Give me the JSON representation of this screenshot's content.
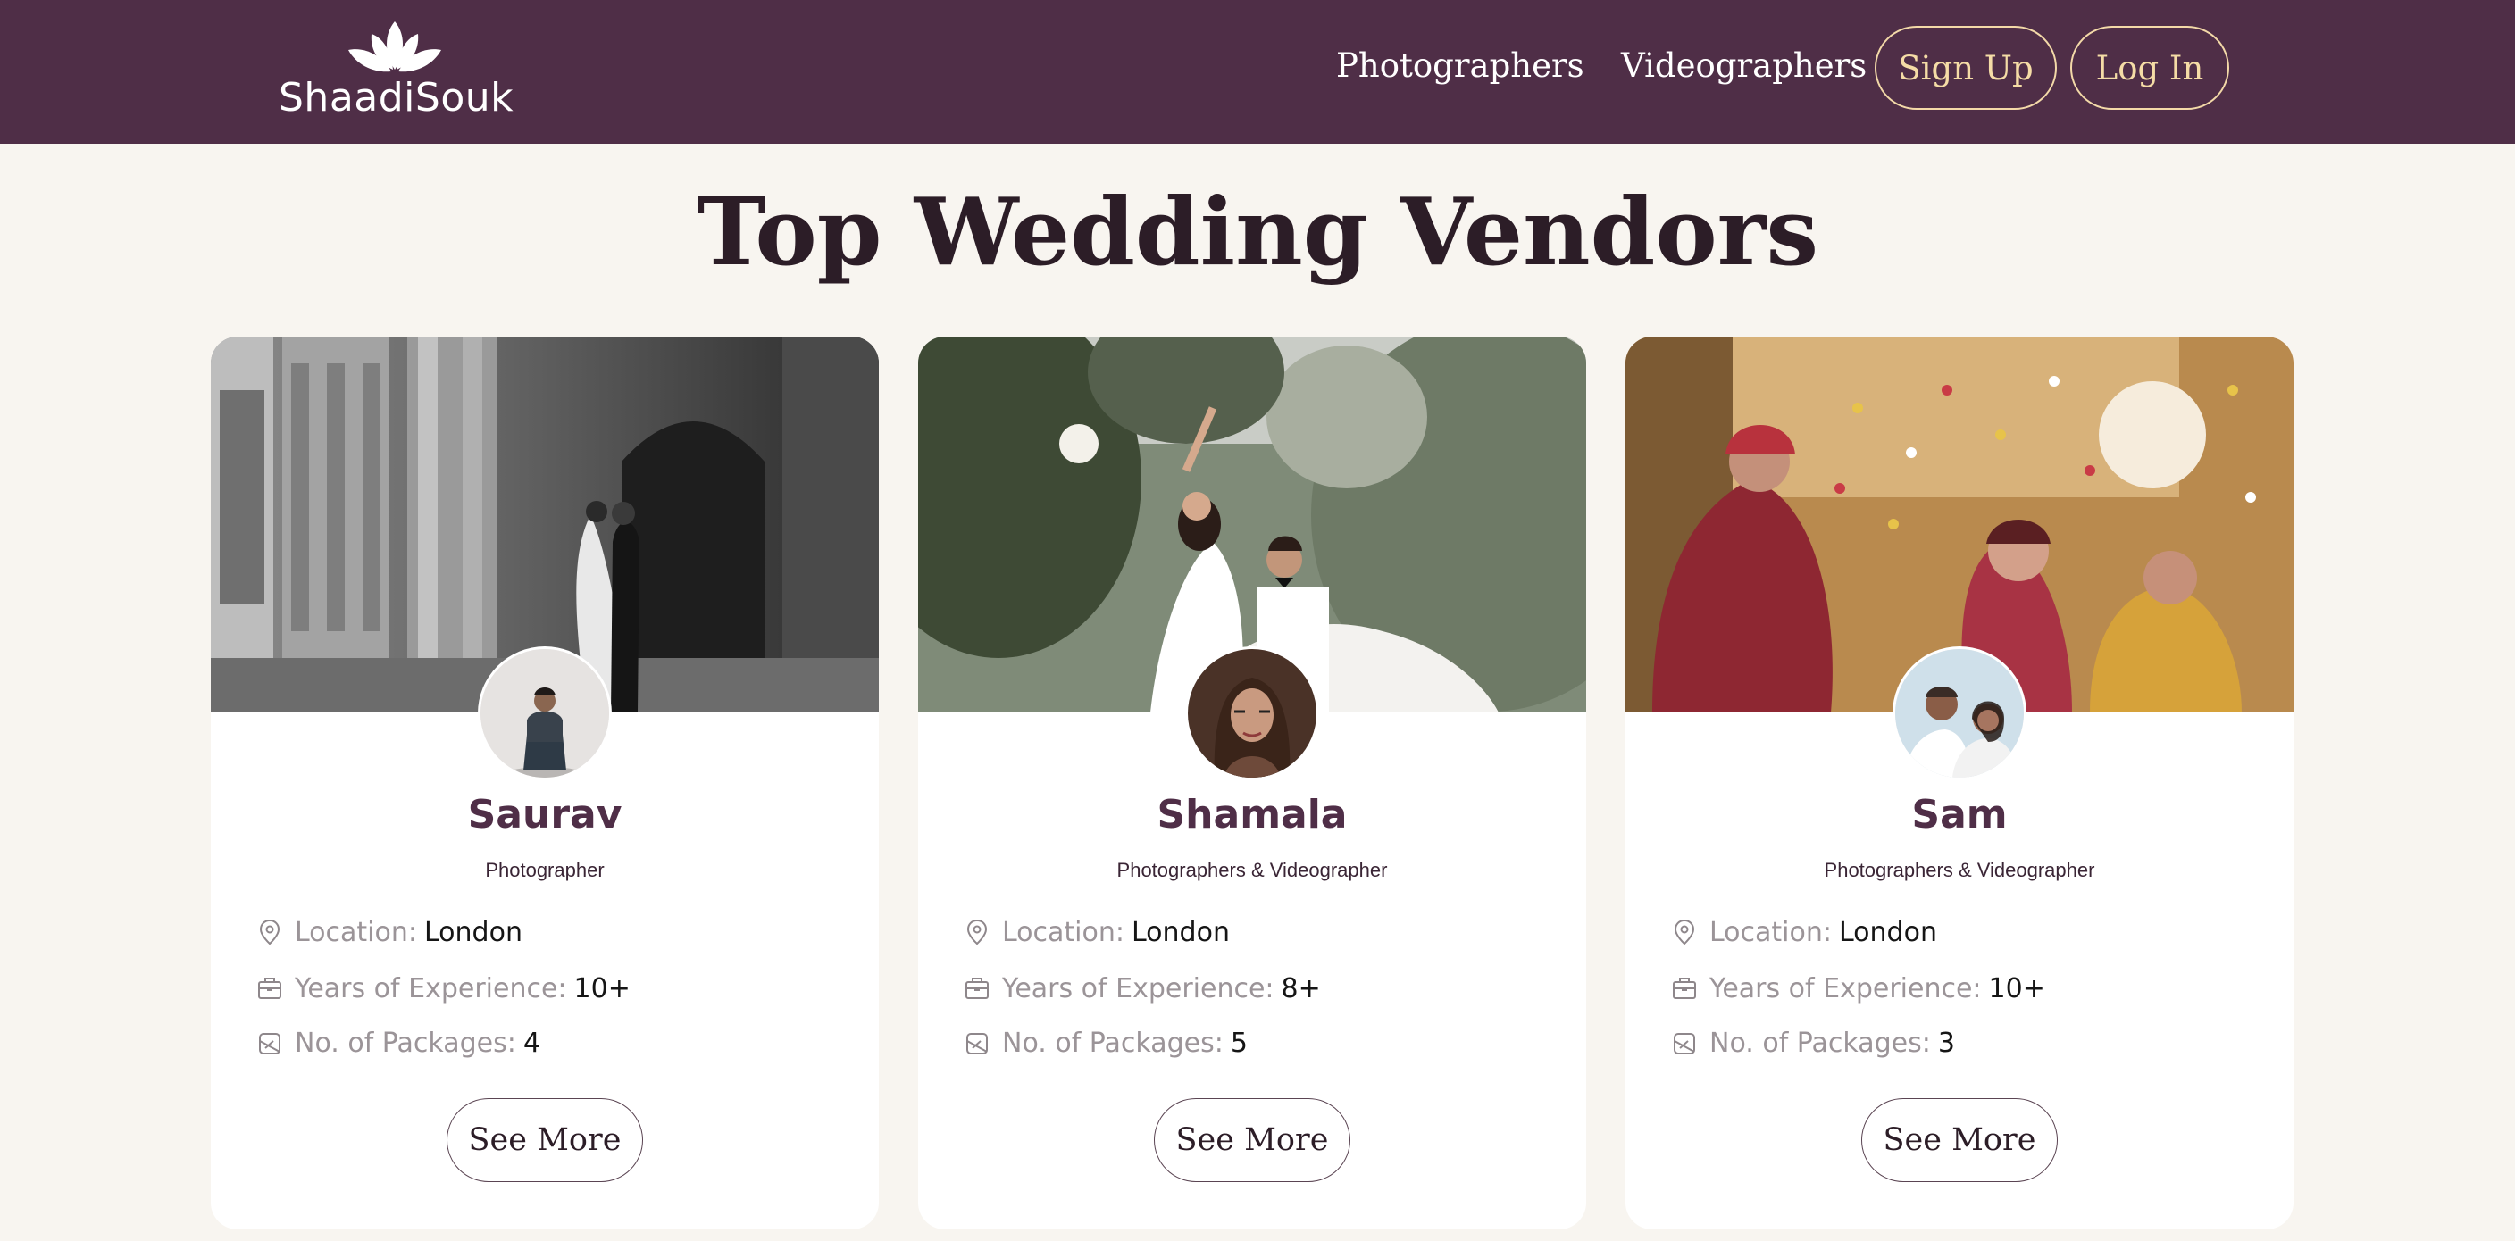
{
  "brand": {
    "name": "ShaadiSouk"
  },
  "nav": {
    "photographers": "Photographers",
    "videographers": "Videographers",
    "sign_up": "Sign Up",
    "log_in": "Log In"
  },
  "page": {
    "title": "Top Wedding Vendors"
  },
  "vendors": [
    {
      "name": "Saurav",
      "role": "Photographer",
      "location_label": "Location:",
      "location": "London",
      "experience_label": "Years of Experience:",
      "experience": "10+",
      "packages_label": "No. of Packages:",
      "packages": "4",
      "button": "See More"
    },
    {
      "name": "Shamala",
      "role": "Photographers & Videographer",
      "location_label": "Location:",
      "location": "London",
      "experience_label": "Years of Experience:",
      "experience": "8+",
      "packages_label": "No. of Packages:",
      "packages": "5",
      "button": "See More"
    },
    {
      "name": "Sam",
      "role": "Photographers & Videographer",
      "location_label": "Location:",
      "location": "London",
      "experience_label": "Years of Experience:",
      "experience": "10+",
      "packages_label": "No. of Packages:",
      "packages": "3",
      "button": "See More"
    }
  ],
  "colors": {
    "header_bg": "#4f2e47",
    "page_bg": "#f8f5f0",
    "accent_gold": "#f5dca6",
    "vendor_name": "#4f2e47"
  },
  "icons": {
    "logo": "lotus-icon",
    "location": "map-pin-icon",
    "experience": "briefcase-icon",
    "packages": "package-icon"
  }
}
